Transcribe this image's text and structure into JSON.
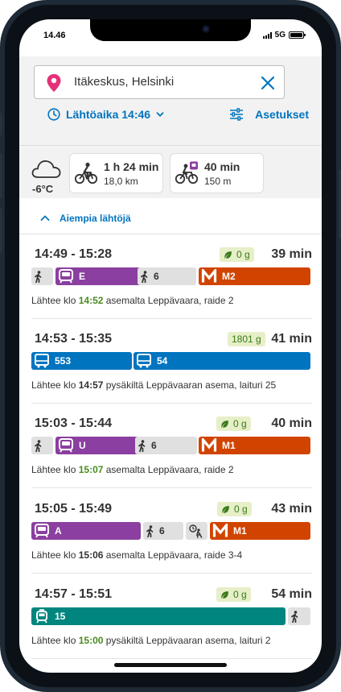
{
  "status": {
    "time": "14.46",
    "network": "5G"
  },
  "search": {
    "location": "Itäkeskus, Helsinki"
  },
  "controls": {
    "departure_label": "Lähtöaika 14:46",
    "settings_label": "Asetukset"
  },
  "weather": {
    "temp": "-6°C",
    "icon": "cloud-icon"
  },
  "modes": [
    {
      "icon": "bicycle-icon",
      "duration": "1 h 24 min",
      "distance": "18,0 km"
    },
    {
      "icon": "citybike-icon",
      "duration": "40 min",
      "distance": "150 m"
    }
  ],
  "earlier_label": "Aiempia lähtöjä",
  "itineraries": [
    {
      "time": "14:49 - 15:28",
      "duration": "39 min",
      "co2": "0 g",
      "leaf": true,
      "legs": [
        {
          "type": "walk",
          "label": ""
        },
        {
          "type": "train",
          "label": "E",
          "color": "#8b3fa0"
        },
        {
          "type": "walk",
          "label": "6"
        },
        {
          "type": "metro",
          "label": "M2",
          "color": "#d14400"
        }
      ],
      "desc": {
        "a": "Lähtee klo ",
        "time": "14:52",
        "b": " asemalta Leppävaara, raide 2",
        "green": true
      }
    },
    {
      "time": "14:53 - 15:35",
      "duration": "41 min",
      "co2": "1801 g",
      "leaf": false,
      "legs": [
        {
          "type": "bus",
          "label": "553",
          "color": "#0074bf"
        },
        {
          "type": "bus",
          "label": "54",
          "color": "#0074bf"
        }
      ],
      "desc": {
        "a": "Lähtee klo ",
        "time": "14:57",
        "b": " pysäkiltä Leppävaaran asema, laituri 25",
        "green": false
      }
    },
    {
      "time": "15:03 - 15:44",
      "duration": "40 min",
      "co2": "0 g",
      "leaf": true,
      "legs": [
        {
          "type": "walk",
          "label": ""
        },
        {
          "type": "train",
          "label": "U",
          "color": "#8b3fa0"
        },
        {
          "type": "walk",
          "label": "6"
        },
        {
          "type": "metro",
          "label": "M1",
          "color": "#d14400"
        }
      ],
      "desc": {
        "a": "Lähtee klo ",
        "time": "15:07",
        "b": " asemalta Leppävaara, raide 2",
        "green": true
      }
    },
    {
      "time": "15:05 - 15:49",
      "duration": "43 min",
      "co2": "0 g",
      "leaf": true,
      "legs": [
        {
          "type": "train",
          "label": "A",
          "color": "#8b3fa0"
        },
        {
          "type": "walk",
          "label": "6"
        },
        {
          "type": "wait",
          "label": ""
        },
        {
          "type": "metro",
          "label": "M1",
          "color": "#d14400"
        }
      ],
      "desc": {
        "a": "Lähtee klo ",
        "time": "15:06",
        "b": " asemalta Leppävaara, raide 3-4",
        "green": false
      }
    },
    {
      "time": "14:57 - 15:51",
      "duration": "54 min",
      "co2": "0 g",
      "leaf": true,
      "legs": [
        {
          "type": "tram",
          "label": "15",
          "color": "#00867f"
        },
        {
          "type": "walk",
          "label": ""
        }
      ],
      "desc": {
        "a": "Lähtee klo ",
        "time": "15:00",
        "b": " pysäkiltä Leppävaaran asema, laituri 2",
        "green": true
      }
    }
  ]
}
